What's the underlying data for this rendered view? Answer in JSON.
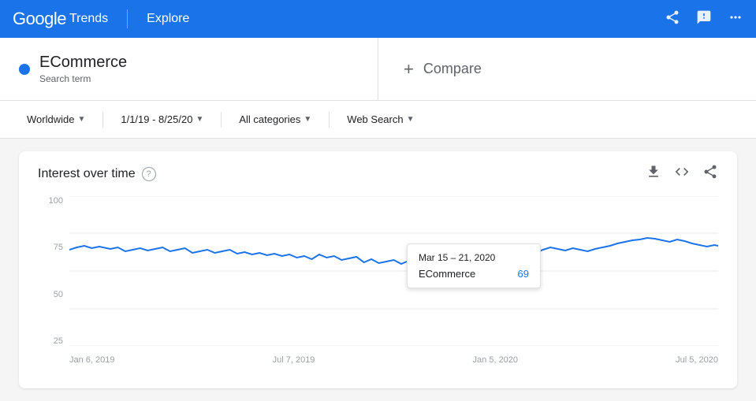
{
  "header": {
    "google_label": "Google",
    "trends_label": "Trends",
    "explore_label": "Explore",
    "share_icon": "share",
    "feedback_icon": "feedback",
    "apps_icon": "apps"
  },
  "search": {
    "term_name": "ECommerce",
    "term_type": "Search term",
    "compare_label": "Compare",
    "compare_plus": "+"
  },
  "filters": {
    "location": "Worldwide",
    "date_range": "1/1/19 - 8/25/20",
    "category": "All categories",
    "search_type": "Web Search"
  },
  "card": {
    "title": "Interest over time",
    "help": "?",
    "download_icon": "download",
    "code_icon": "code",
    "share_icon": "share"
  },
  "chart": {
    "y_labels": [
      "100",
      "75",
      "50",
      "25"
    ],
    "x_labels": [
      "Jan 6, 2019",
      "Jul 7, 2019",
      "Jan 5, 2020",
      "Jul 5, 2020"
    ],
    "tooltip": {
      "date": "Mar 15 – 21, 2020",
      "term": "ECommerce",
      "value": "69"
    },
    "accent_color": "#1a73e8"
  }
}
